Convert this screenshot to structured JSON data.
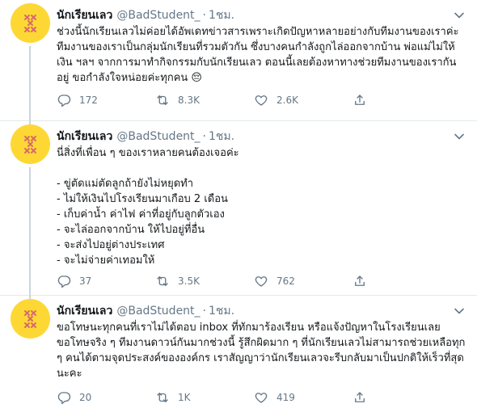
{
  "colors": {
    "avatar_bg": "#fdd835",
    "avatar_mark": "#d96a6a",
    "text_secondary": "#657786",
    "thread_line": "#ccd6dd"
  },
  "tweets": [
    {
      "name": "นักเรียนเลว",
      "handle": "@BadStudent_",
      "dot": "·",
      "time": "1ชม.",
      "text": "ช่วงนี้นักเรียนเลวไม่ค่อยได้อัพเดทข่าวสารเพราะเกิดปัญหาหลายอย่างกับทีมงานของเราค่ะ ทีมงานของเราเป็นกลุ่มนักเรียนที่รวมตัวกัน ซึ่งบางคนกำลังถูกไล่ออกจากบ้าน พ่อแม่ไม่ให้เงิน ฯลฯ จากการมาทำกิจกรรมกับนักเรียนเลว ตอนนี้เลยต้องหาทางช่วยทีมงานของเรากันอยู่ ขอกำลังใจหน่อยค่ะทุกคน 😔",
      "replies": "172",
      "retweets": "8.3K",
      "likes": "2.6K"
    },
    {
      "name": "นักเรียนเลว",
      "handle": "@BadStudent_",
      "dot": "·",
      "time": "1ชม.",
      "text": "นี่สิ่งที่เพื่อน ๆ ของเราหลายคนต้องเจอค่ะ\n\n- ขู่ตัดแม่ตัดลูกถ้ายังไม่หยุดทำ\n- ไม่ให้เงินไปโรงเรียนมาเกือบ 2 เดือน\n- เก็บค่าน้ำ ค่าไฟ ค่าที่อยู่กับลูกตัวเอง\n- จะไล่ออกจากบ้าน ให้ไปอยู่ที่อื่น\n- จะส่งไปอยู่ต่างประเทศ\n- จะไม่จ่ายค่าเทอมให้",
      "replies": "37",
      "retweets": "3.5K",
      "likes": "762"
    },
    {
      "name": "นักเรียนเลว",
      "handle": "@BadStudent_",
      "dot": "·",
      "time": "1ชม.",
      "text": "ขอโทษนะทุกคนที่เราไม่ได้ตอบ inbox ที่ทักมาร้องเรียน หรือแจ้งปัญหาในโรงเรียนเลย ขอโทษจริง ๆ ทีมงานดาวน์กันมากช่วงนี้ รู้สึกผิดมาก ๆ ที่นักเรียนเลวไม่สามารถช่วยเหลือทุก ๆ คนได้ตามจุดประสงค์ขององค์กร เราสัญญาว่านักเรียนเลวจะรีบกลับมาเป็นปกติให้เร็วที่สุดนะคะ",
      "replies": "20",
      "retweets": "1K",
      "likes": "419"
    }
  ]
}
